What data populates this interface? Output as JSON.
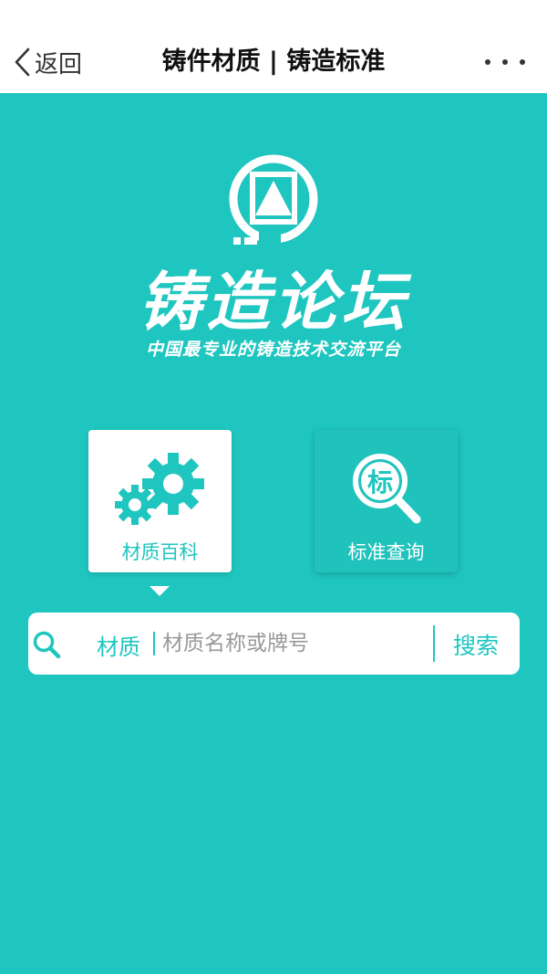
{
  "nav": {
    "back_label": "返回",
    "title": "铸件材质 | 铸造标准"
  },
  "brand": {
    "title": "铸造论坛",
    "subtitle": "中国最专业的铸造技术交流平台"
  },
  "cards": [
    {
      "label": "材质百科",
      "icon": "gears-icon",
      "selected": true
    },
    {
      "label": "标准查询",
      "icon": "standard-search-icon",
      "selected": false
    }
  ],
  "standard_icon_char": "标",
  "search": {
    "type_label": "材质",
    "placeholder": "材质名称或牌号",
    "value": "",
    "button_label": "搜索"
  },
  "colors": {
    "primary": "#1fc6bf",
    "white": "#ffffff"
  }
}
